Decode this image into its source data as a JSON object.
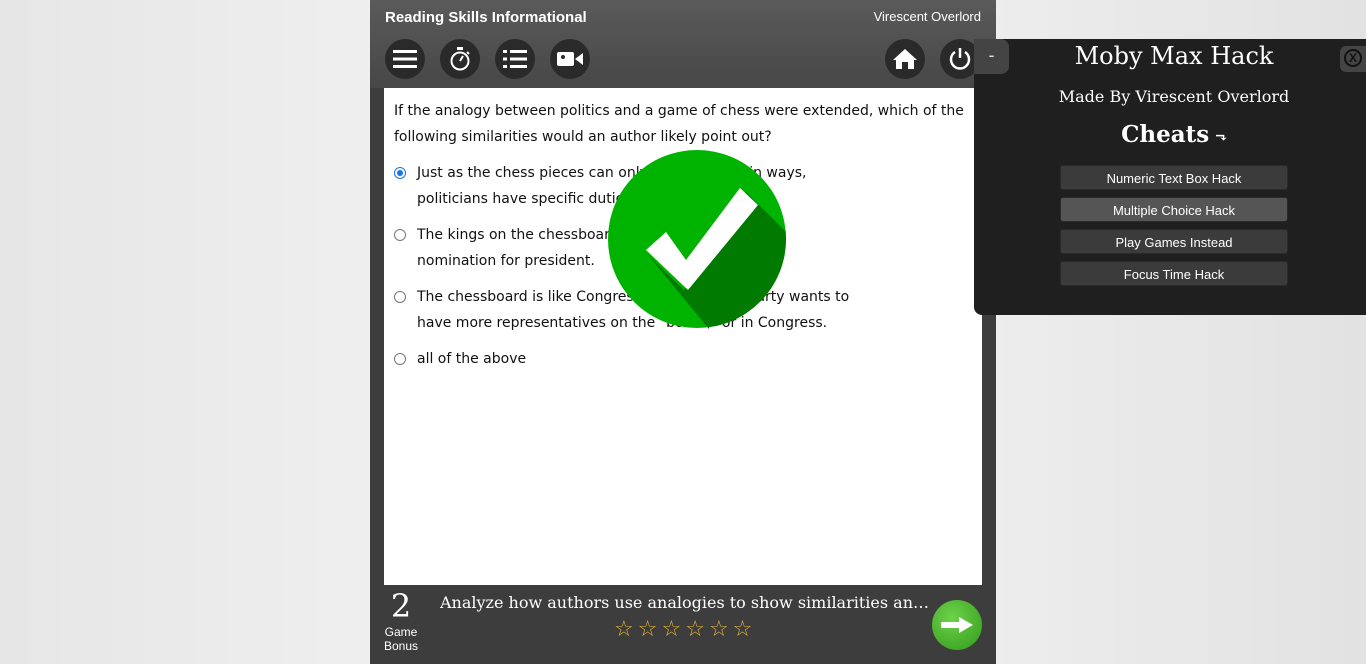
{
  "app": {
    "title": "Reading Skills Informational",
    "user_name": "Virescent Overlord"
  },
  "toolbar": {
    "left_icons": [
      "menu-icon",
      "timer-icon",
      "list-icon",
      "video-icon"
    ],
    "right_icons": [
      "home-icon",
      "power-icon"
    ]
  },
  "question": {
    "text": "If the analogy between politics and a game of chess were extended, which of the following similarities would an author likely point out?",
    "choices": [
      {
        "text": "Just as the chess pieces can only move in certain ways, politicians have specific duties.",
        "selected": true
      },
      {
        "text": "The kings on the chessboard represent each party's nomination for president.",
        "selected": false
      },
      {
        "text": "The chessboard is like Congress; each political party wants to have more representatives on the \"board,\" or in Congress.",
        "selected": false
      },
      {
        "text": "all of the above",
        "selected": false
      }
    ],
    "visible_lines": [
      [
        "Just as the chess pieces can only move in certain ways,",
        "politicians have specific duties."
      ],
      [
        "The kings on the chessboard represent each party's",
        "nomination for president."
      ],
      [
        "The chessboard is like Congress; each political party wants to",
        "have more representatives on the \"board,\" or in Congress."
      ],
      [
        "all of the above"
      ]
    ],
    "feedback_icon": "checkmark-icon"
  },
  "footer": {
    "bonus_count": "2",
    "bonus_label_line1": "Game",
    "bonus_label_line2": "Bonus",
    "objective": "Analyze how authors use analogies to show similarities and differences",
    "stars_filled": 0,
    "stars_total": 6,
    "next_icon": "arrow-right-icon"
  },
  "hack_panel": {
    "minimize_label": "-",
    "title": "Moby Max Hack",
    "subtitle": "Made By Virescent Overlord",
    "cheats_heading": "Cheats",
    "cheats_arrow": "⬎",
    "close_label": "X",
    "buttons": [
      {
        "label": "Numeric Text Box Hack",
        "active": false
      },
      {
        "label": "Multiple Choice Hack",
        "active": true
      },
      {
        "label": "Play Games Instead",
        "active": false
      },
      {
        "label": "Focus Time Hack",
        "active": false
      }
    ]
  },
  "colors": {
    "header": "#4f4f4f",
    "panel": "#3d3d3d",
    "check_green": "#00b300",
    "check_dark": "#006b00",
    "next_green": "#3fb025",
    "star": "#e2b23b",
    "radio_selected": "#1a73e8"
  }
}
